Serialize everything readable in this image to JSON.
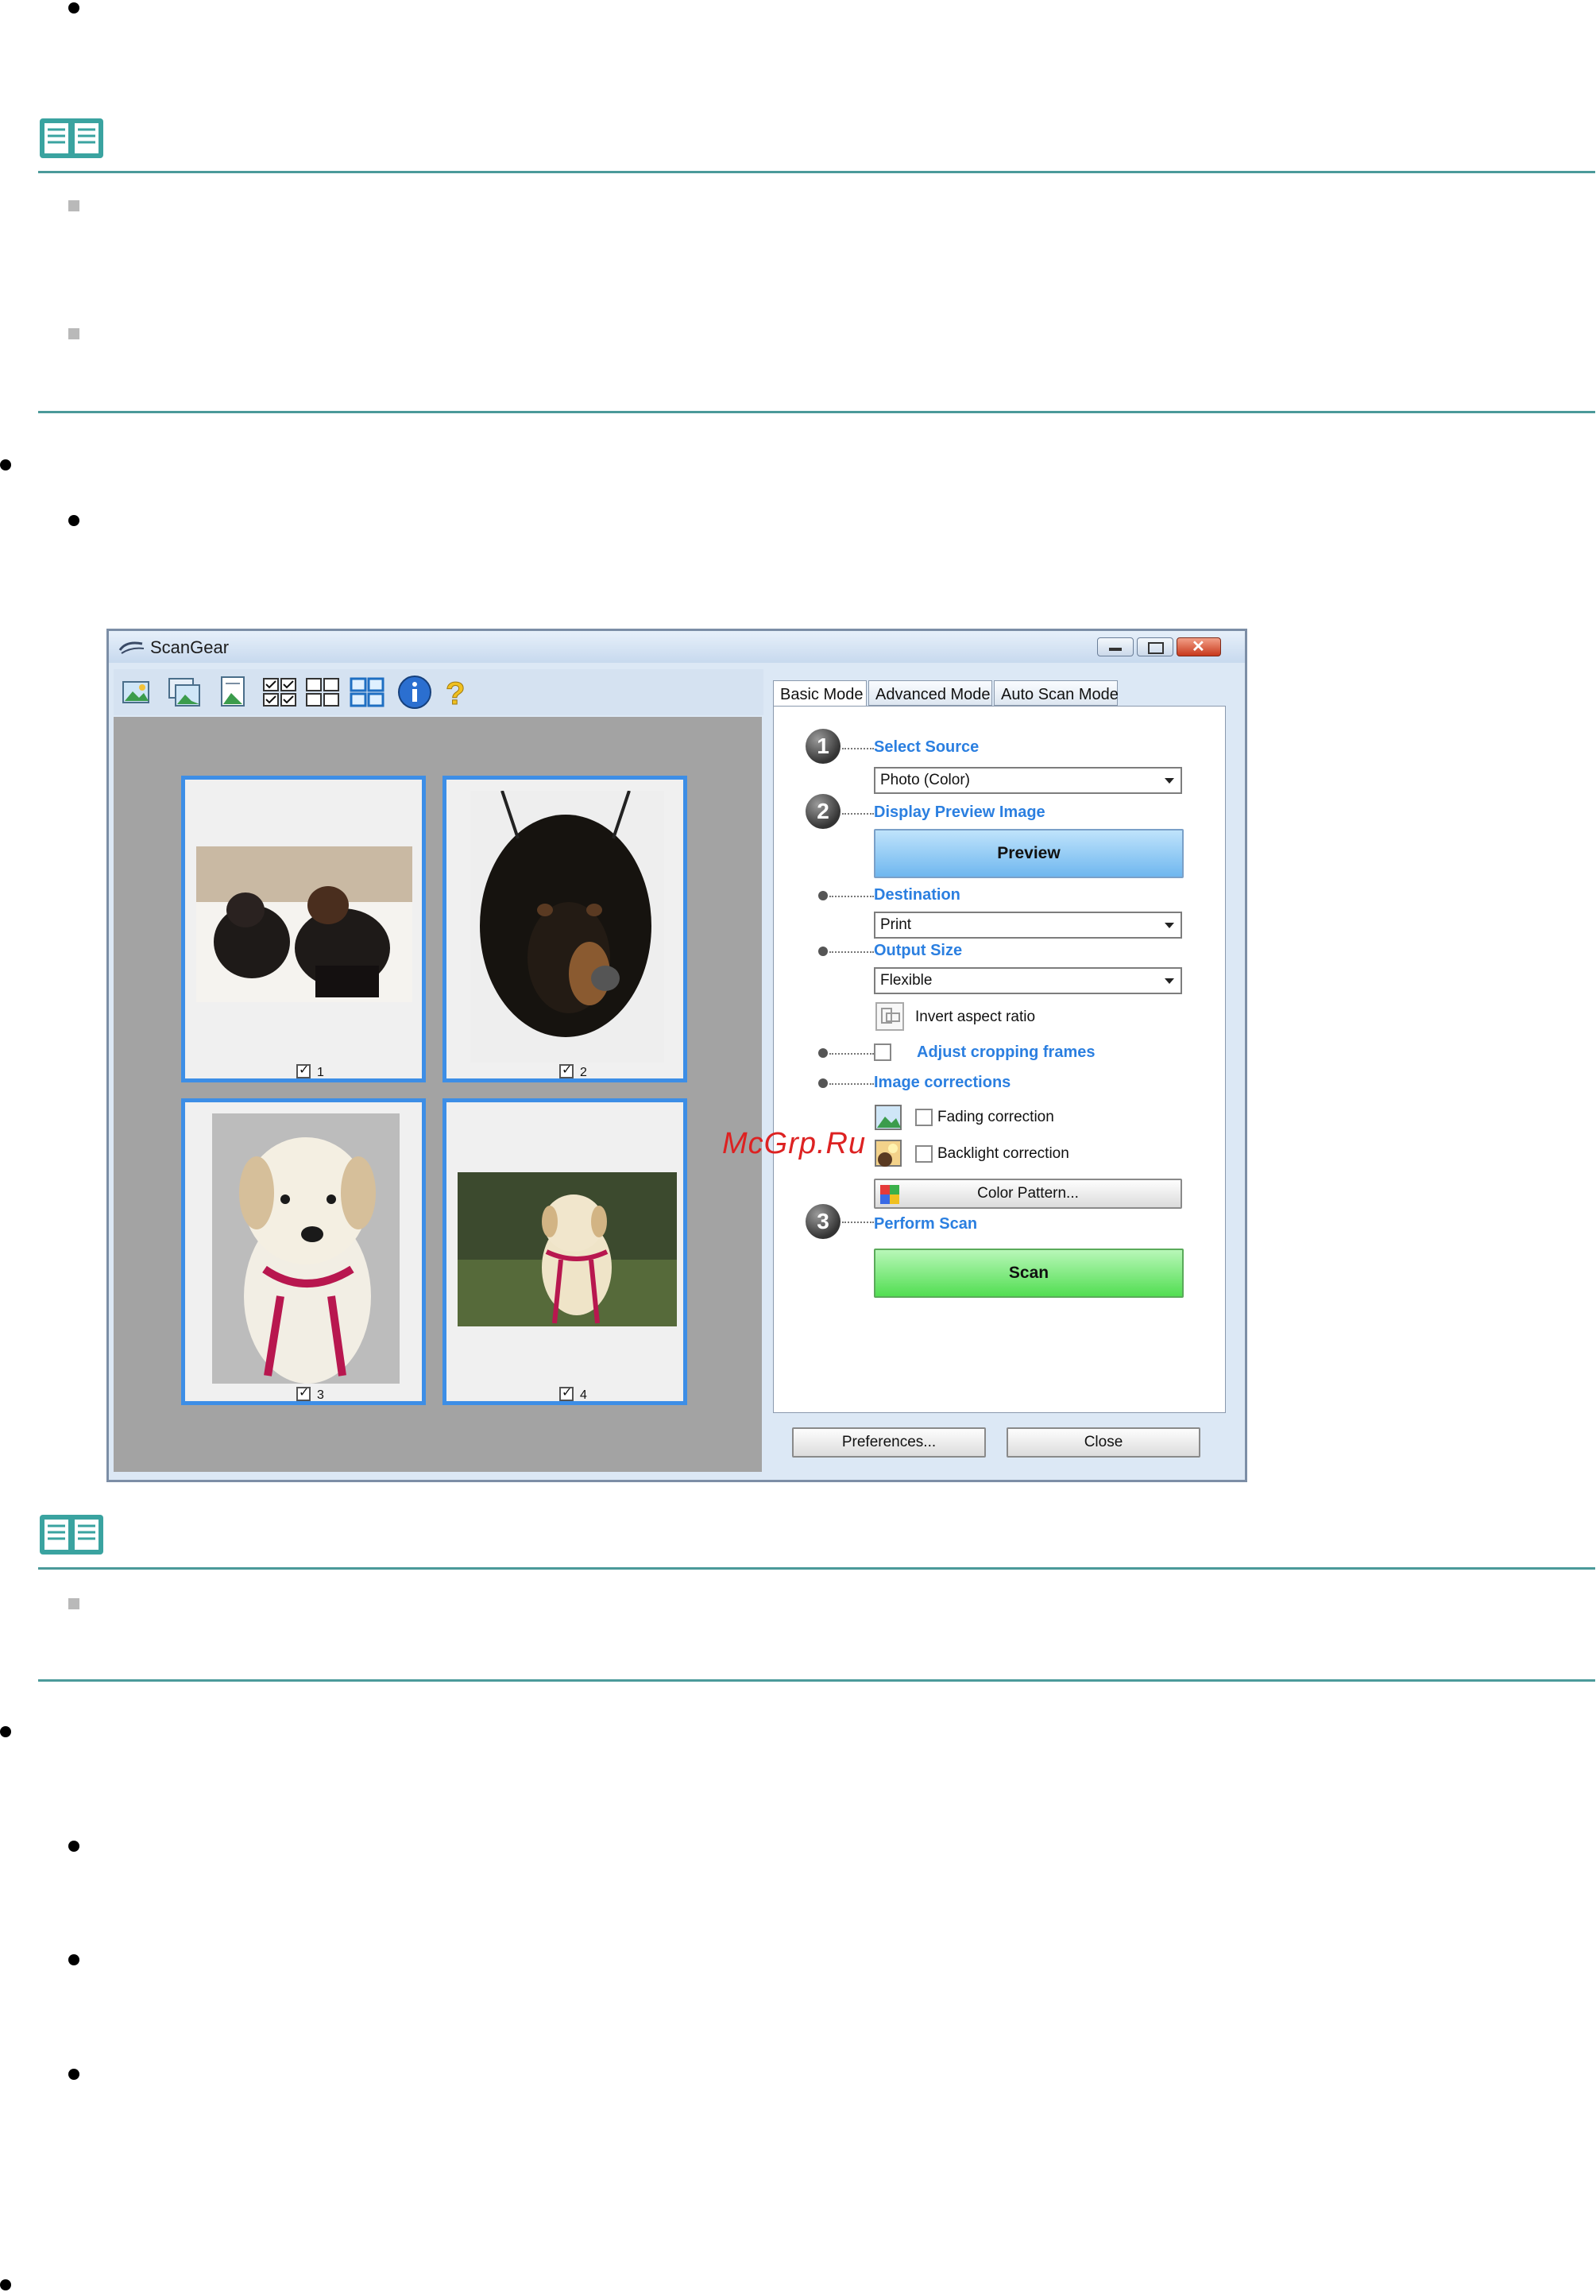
{
  "window": {
    "title": "ScanGear",
    "tabs": [
      "Basic Mode",
      "Advanced Mode",
      "Auto Scan Mode"
    ],
    "toolbar_icons": [
      "scan-photo-icon",
      "scan-multi-icon",
      "scan-doc-icon",
      "select-all-icon",
      "deselect-icon",
      "thumbnail-view-icon",
      "info-icon",
      "help-icon"
    ]
  },
  "thumbnails": [
    {
      "label": "1"
    },
    {
      "label": "2"
    },
    {
      "label": "3"
    },
    {
      "label": "4"
    }
  ],
  "panel": {
    "step1": {
      "num": "1",
      "label": "Select Source",
      "select_value": "Photo (Color)"
    },
    "step2": {
      "num": "2",
      "label": "Display Preview Image",
      "button": "Preview"
    },
    "destination": {
      "label": "Destination",
      "select_value": "Print"
    },
    "output_size": {
      "label": "Output Size",
      "select_value": "Flexible"
    },
    "invert_aspect": "Invert aspect ratio",
    "adjust_cropping": "Adjust cropping frames",
    "image_corrections": {
      "label": "Image corrections",
      "fading": "Fading correction",
      "backlight": "Backlight correction",
      "color_pattern": "Color Pattern..."
    },
    "step3": {
      "num": "3",
      "label": "Perform Scan",
      "button": "Scan"
    },
    "preferences": "Preferences...",
    "close": "Close"
  },
  "watermark": "McGrp.Ru",
  "colors": {
    "accent": "#2b7fe0",
    "rule": "#4b9a9a",
    "scan_button": "#5ee65e",
    "preview_button": "#7fc2f5"
  }
}
